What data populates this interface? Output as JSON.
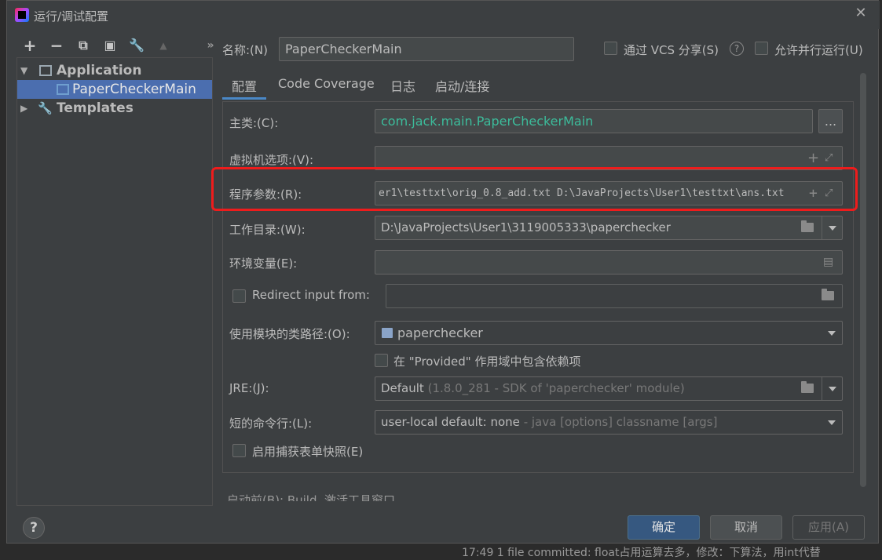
{
  "window": {
    "title": "运行/调试配置"
  },
  "sidebar": {
    "toolbar_icons": [
      "add-icon",
      "remove-icon",
      "copy-icon",
      "save-icon",
      "wrench-icon",
      "up-icon",
      "more-icon"
    ],
    "tree": [
      {
        "label": "Application",
        "expanded": true
      },
      {
        "label": "PaperCheckerMain",
        "selected": true
      },
      {
        "label": "Templates",
        "expanded": false
      }
    ]
  },
  "header": {
    "name_label": "名称:(N)",
    "name_value": "PaperCheckerMain",
    "share_vcs": "通过 VCS 分享(S)",
    "allow_parallel": "允许并行运行(U)"
  },
  "tabs": [
    "配置",
    "Code Coverage",
    "日志",
    "启动/连接"
  ],
  "form": {
    "main_class_label": "主类:(C):",
    "main_class_value": "com.jack.main.PaperCheckerMain",
    "main_class_btn": "...",
    "vm_options_label": "虚拟机选项:(V):",
    "vm_options_value": "",
    "program_args_label": "程序参数:(R):",
    "program_args_value": "er1\\testtxt\\orig_0.8_add.txt D:\\JavaProjects\\User1\\testtxt\\ans.txt",
    "workdir_label": "工作目录:(W):",
    "workdir_value": "D:\\JavaProjects\\User1\\3119005333\\paperchecker",
    "env_label": "环境变量(E):",
    "env_value": "",
    "redirect_label": "Redirect input from:",
    "redirect_value": "",
    "module_label": "使用模块的类路径:(O):",
    "module_value": "paperchecker",
    "provided_label": "在 \"Provided\" 作用域中包含依赖项",
    "jre_label": "JRE:(J):",
    "jre_value": "Default",
    "jre_hint": "(1.8.0_281 - SDK of 'paperchecker' module)",
    "shorten_label": "短的命令行:(L):",
    "shorten_value": "user-local default: none",
    "shorten_hint": "- java [options] classname [args]",
    "snapshot_label": "启用捕获表单快照(E)",
    "before_launch": "启动前(B): Build, 激活工具窗口"
  },
  "buttons": {
    "ok": "确定",
    "cancel": "取消",
    "apply": "应用(A)",
    "help": "?"
  },
  "background": {
    "status_text": "17:49    1 file committed: float占用运算去多，修改：下算法，用int代替"
  },
  "colors": {
    "accent": "#4a88c7",
    "selection": "#4b6eaf",
    "highlight_box": "#ee1c1c",
    "class_text": "#3cbc9b"
  }
}
